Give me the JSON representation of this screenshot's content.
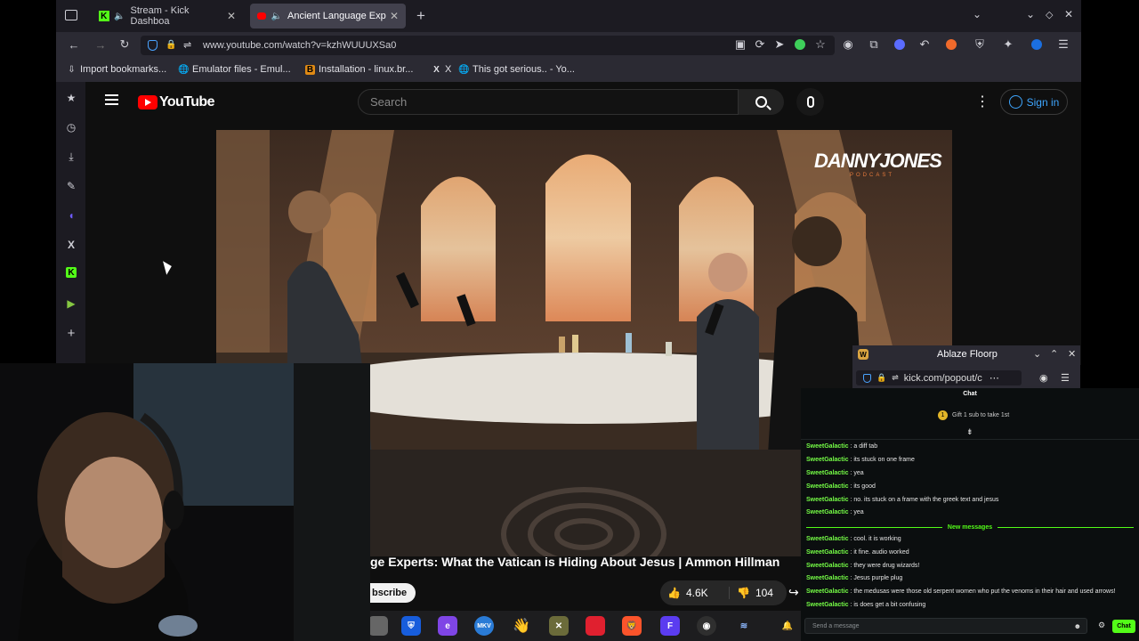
{
  "browser": {
    "tabs": [
      {
        "title": "Stream - Kick Dashboa",
        "active": false
      },
      {
        "title": "Ancient Language Exp",
        "active": true
      }
    ],
    "url": "www.youtube.com/watch?v=kzhWUUUXSa0",
    "bookmarks": [
      "Import bookmarks...",
      "Emulator files - Emul...",
      "Installation - linux.br...",
      "X",
      "This got serious.. - Yo..."
    ]
  },
  "youtube": {
    "logo_text": "YouTube",
    "search_placeholder": "Search",
    "signin_label": "Sign in",
    "channel_watermark": "DANNYJONES",
    "channel_watermark_sub": "PODCAST",
    "video_title": "ge Experts: What the Vatican is Hiding About Jesus | Ammon Hillman",
    "subscribe_label": "bscribe",
    "likes": "4.6K",
    "dislikes": "104"
  },
  "kick_popout": {
    "window_title": "Ablaze Floorp",
    "url": "kick.com/popout/c",
    "chat_header": "Chat",
    "gift_text": "Gift 1 sub to take 1st",
    "new_messages_label": "New messages",
    "send_placeholder": "Send a message",
    "chat_button": "Chat"
  },
  "chat_messages": [
    {
      "user": "SweetGalactic",
      "text": "a diff tab"
    },
    {
      "user": "SweetGalactic",
      "text": "its stuck on one frame"
    },
    {
      "user": "SweetGalactic",
      "text": "yea"
    },
    {
      "user": "SweetGalactic",
      "text": "its good"
    },
    {
      "user": "SweetGalactic",
      "text": "no. its stuck on a frame with the greek text and jesus"
    },
    {
      "user": "SweetGalactic",
      "text": "yea"
    }
  ],
  "chat_new_messages": [
    {
      "user": "SweetGalactic",
      "text": "cool. it is working"
    },
    {
      "user": "SweetGalactic",
      "text": "it fine. audio worked"
    },
    {
      "user": "SweetGalactic",
      "text": "they were drug wizards!"
    },
    {
      "user": "SweetGalactic",
      "text": "Jesus purple plug"
    },
    {
      "user": "SweetGalactic",
      "text": "the medusas were those old serpent women who put the venoms in their hair and used arrows!"
    },
    {
      "user": "SweetGalactic",
      "text": "is does get a bit confusing"
    }
  ],
  "colors": {
    "kick_green": "#53fc18",
    "youtube_red": "#ff0000",
    "link_blue": "#3ea6ff",
    "chat_username": "#75fd46"
  }
}
